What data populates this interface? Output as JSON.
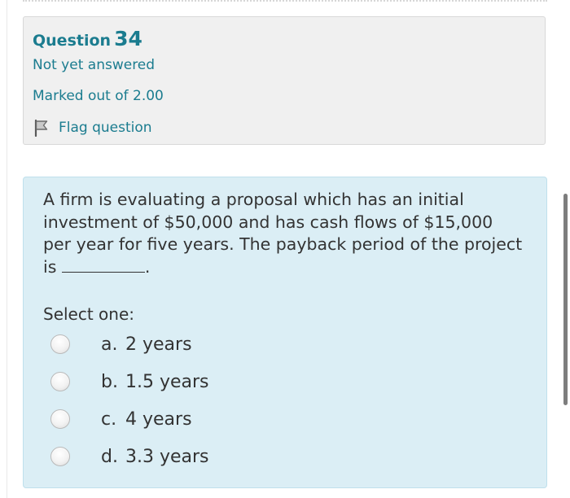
{
  "question_info": {
    "label": "Question",
    "number": "34",
    "state": "Not yet answered",
    "grade": "Marked out of 2.00",
    "flag_label": "Flag question",
    "flag_icon": "flag-icon"
  },
  "question": {
    "text_before_blank": "A firm is evaluating a proposal which has an initial investment of $50,000 and has cash flows of $15,000 per year for five years. The payback period of the project is ",
    "text_after_blank": ".",
    "prompt": "Select one:",
    "options": [
      {
        "letter": "a.",
        "text": "2 years"
      },
      {
        "letter": "b.",
        "text": "1.5 years"
      },
      {
        "letter": "c.",
        "text": "4 years"
      },
      {
        "letter": "d.",
        "text": "3.3 years"
      }
    ]
  },
  "colors": {
    "link": "#1b7c8f",
    "info_background": "#f0f0f0",
    "content_background": "#dbeef5"
  }
}
